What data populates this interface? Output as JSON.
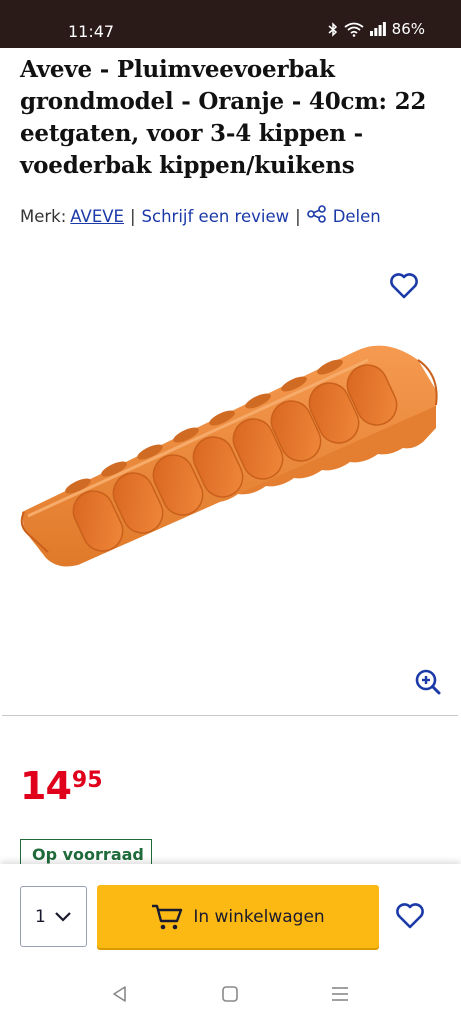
{
  "status_bar": {
    "time": "11:47",
    "battery": "86%",
    "icons": [
      "bluetooth-icon",
      "wifi-icon",
      "signal-icon"
    ]
  },
  "product": {
    "title": "Aveve - Pluimveevoerbak grondmodel - Oranje - 40cm: 22 eetgaten, voor 3-4 kippen - voederbak kippen/kuikens",
    "brand_label": "Merk:",
    "brand_name": "AVEVE",
    "review_link": "Schrijf een review",
    "share_label": "Delen",
    "image_alt": "orange poultry feeder tray"
  },
  "price": {
    "whole": "14",
    "fraction": "95",
    "color": "#e0001b"
  },
  "stock_status": "Op voorraad",
  "purchase": {
    "quantity": "1",
    "add_to_cart": "In winkelwagen",
    "button_color": "#fdb913"
  },
  "colors": {
    "link": "#1b3aa8",
    "stock": "#1f6b3a",
    "product": "#f08a3c"
  }
}
